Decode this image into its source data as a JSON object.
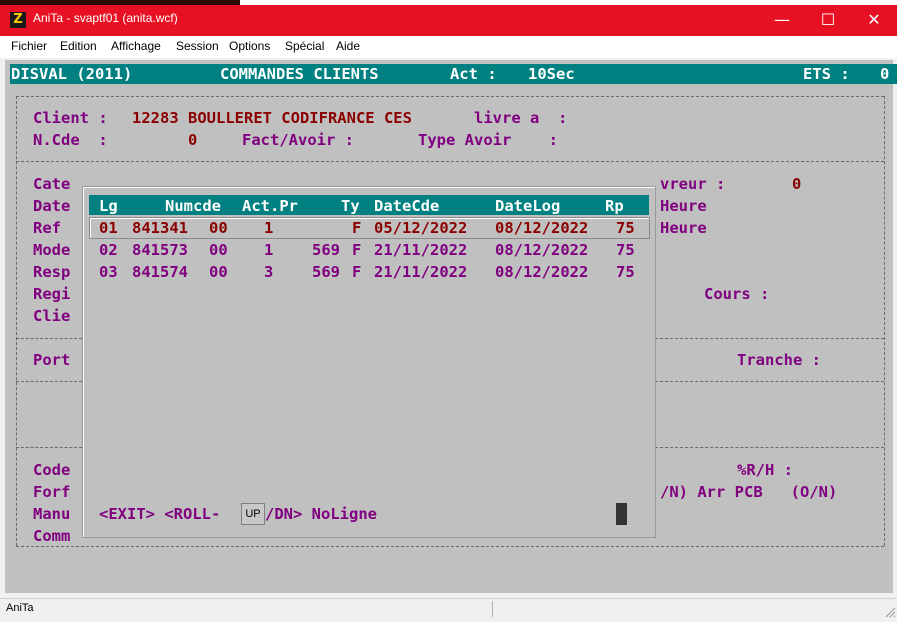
{
  "window": {
    "app_name": "AniTa - ",
    "file": "svaptf01 (anita.wcf)",
    "minimize_glyph": "—",
    "maximize_glyph": "☐",
    "close_glyph": "✕",
    "icon_glyph": "Z"
  },
  "menu": {
    "items": [
      "Fichier",
      "Edition",
      "Affichage",
      "Session",
      "Options",
      "Spécial",
      "Aide"
    ]
  },
  "header": {
    "company": "DISVAL (2011)",
    "title": "COMMANDES CLIENTS",
    "act_label": "Act :",
    "act_value": "10Sec",
    "ets_label": "ETS :",
    "ets_value": "0"
  },
  "client_section": {
    "client_label": "Client :",
    "client_value": "12283 BOULLERET CODIFRANCE CES",
    "livre_label": "livre a  :",
    "ncde_label": "N.Cde  :",
    "ncde_value": "0",
    "fact_label": "Fact/Avoir :",
    "type_label": "Type Avoir    :"
  },
  "form_left_labels": [
    "Cate",
    "Date",
    "Ref",
    "Mode",
    "Resp",
    "Regi",
    "Clie"
  ],
  "form_right": {
    "vreur_label": "vreur :",
    "vreur_value": "0",
    "heure1": "Heure",
    "heure2": "Heure",
    "cours_label": "Cours :",
    "port_label": "Port",
    "tranche_label": "Tranche :",
    "code_label": "Code",
    "forf_label": "Forf",
    "manu_label": "Manu",
    "comm_label": "Comm",
    "rh_label": "%R/H :",
    "arr_label": "/N) Arr PCB   (O/N)"
  },
  "popup": {
    "columns": {
      "lg": "Lg",
      "numcde": "Numcde",
      "act_pr": "Act.Pr",
      "ty": "Ty",
      "datecde": "DateCde",
      "datelog": "DateLog",
      "rp": "Rp"
    },
    "rows": [
      {
        "lg": "01",
        "numcde": "841341",
        "sub": "00",
        "act": "1",
        "pr": "",
        "ty": "F",
        "datecde": "05/12/2022",
        "datelog": "08/12/2022",
        "rp": "75"
      },
      {
        "lg": "02",
        "numcde": "841573",
        "sub": "00",
        "act": "1",
        "pr": "569",
        "ty": "F",
        "datecde": "21/11/2022",
        "datelog": "08/12/2022",
        "rp": "75"
      },
      {
        "lg": "03",
        "numcde": "841574",
        "sub": "00",
        "act": "3",
        "pr": "569",
        "ty": "F",
        "datecde": "21/11/2022",
        "datelog": "08/12/2022",
        "rp": "75"
      }
    ],
    "footer_exit": "<EXIT> <ROLL-",
    "footer_up": "UP",
    "footer_rest": "/DN> NoLigne"
  },
  "statusbar": {
    "text": "AniTa"
  },
  "colors": {
    "titlebar": "#e81123",
    "teal": "#008080",
    "terminal_bg": "#c0c0c0",
    "red_text": "#8b0000",
    "purple_text": "#800080"
  }
}
